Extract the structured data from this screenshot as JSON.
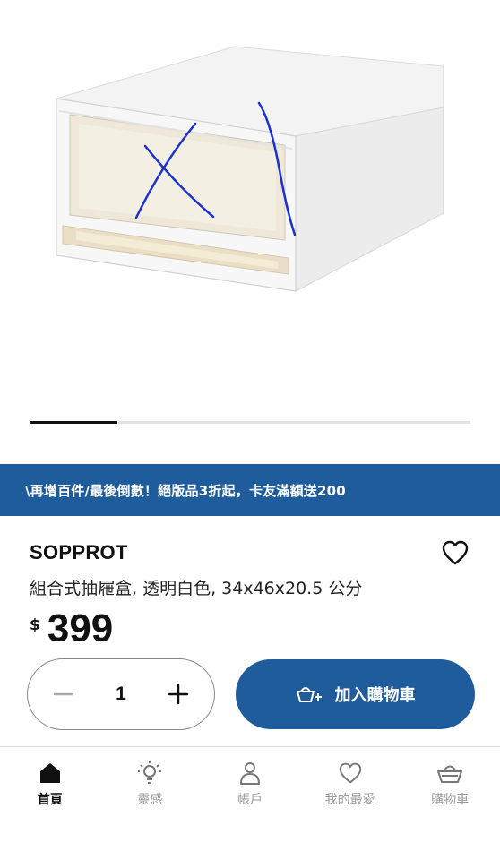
{
  "gallery": {
    "image_alt": "組合式抽屜盒 product image",
    "progress": 0.2,
    "scribble_color": "#1a2fd6"
  },
  "promo": {
    "text": "\\再增百件/最後倒數！絕版品3折起，卡友滿額送200",
    "bg_color": "#1f5c9c"
  },
  "product": {
    "brand": "SOPPROT",
    "description": "組合式抽屜盒, 透明白色, 34x46x20.5 公分",
    "currency": "$",
    "price": "399",
    "favorite_icon": "heart-icon"
  },
  "purchase": {
    "quantity": "1",
    "decrease_icon": "minus-icon",
    "increase_icon": "plus-icon",
    "add_to_cart_label": "加入購物車",
    "add_to_cart_icon": "cart-add-icon"
  },
  "nav": {
    "items": [
      {
        "label": "首頁",
        "icon": "home-icon",
        "active": true
      },
      {
        "label": "靈感",
        "icon": "lightbulb-icon",
        "active": false
      },
      {
        "label": "帳戶",
        "icon": "person-icon",
        "active": false
      },
      {
        "label": "我的最愛",
        "icon": "heart-icon",
        "active": false
      },
      {
        "label": "購物車",
        "icon": "basket-icon",
        "active": false
      }
    ]
  }
}
